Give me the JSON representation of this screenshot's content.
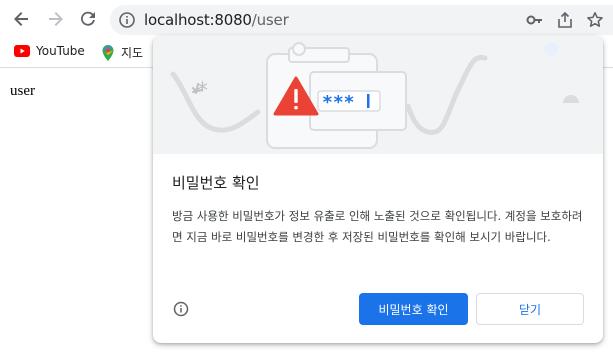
{
  "browser": {
    "url_host": "localhost:8080",
    "url_path": "/user",
    "bookmarks": [
      {
        "label": "YouTube",
        "icon": "youtube-icon"
      },
      {
        "label": "지도",
        "icon": "maps-icon"
      }
    ]
  },
  "page": {
    "text": "user"
  },
  "dialog": {
    "title": "비밀번호 확인",
    "body": "방금 사용한 비밀번호가 정보 유출로 인해 노출된 것으로 확인됩니다. 계정을 보호하려면 지금 바로 비밀번호를 변경한 후 저장된 비밀번호를 확인해 보시기 바랍니다.",
    "masked_password": "***",
    "primary_button": "비밀번호 확인",
    "secondary_button": "닫기"
  },
  "colors": {
    "accent": "#1a73e8",
    "warning": "#ea4335",
    "youtube": "#ff0000"
  }
}
